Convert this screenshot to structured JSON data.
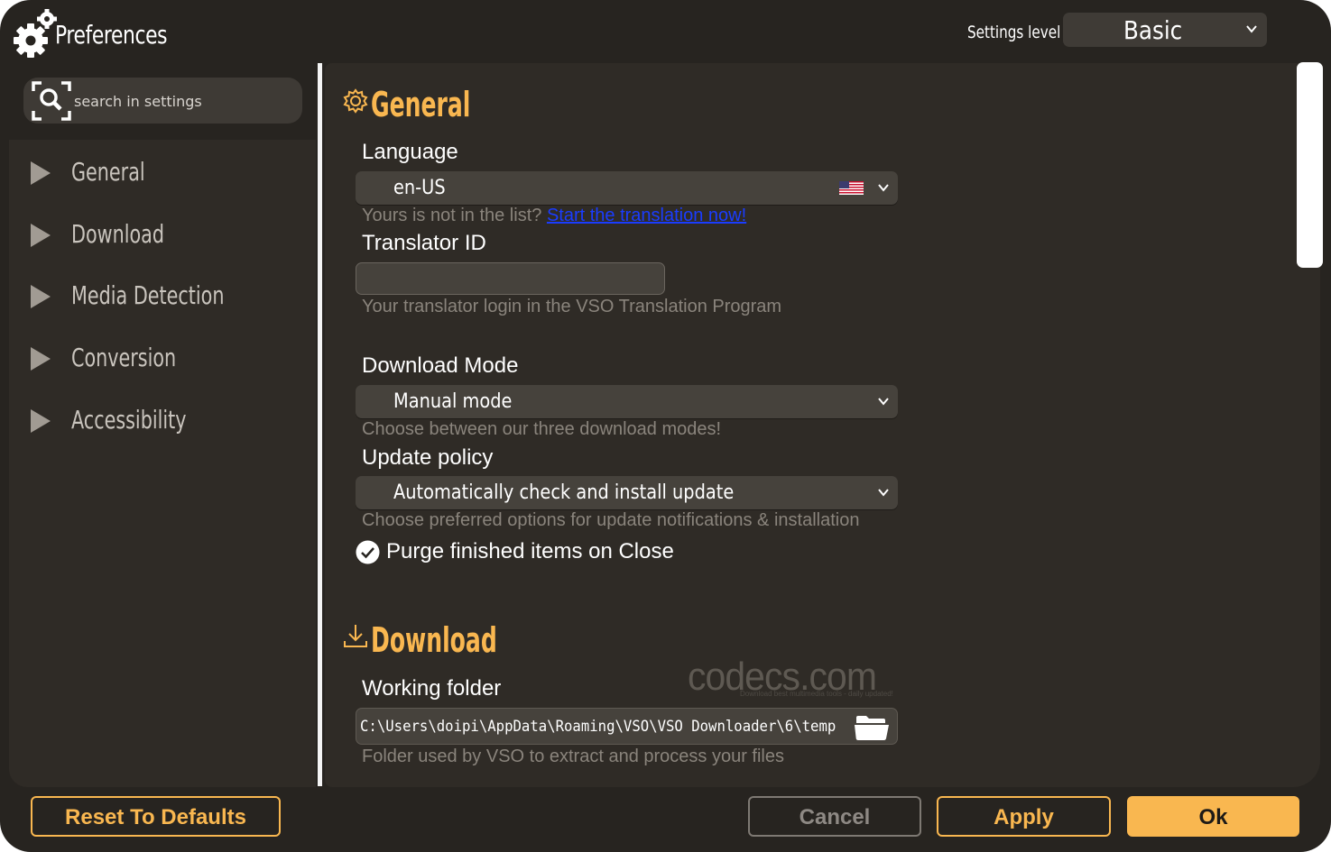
{
  "window": {
    "title": "Preferences"
  },
  "header": {
    "settings_level_label": "Settings level",
    "settings_level_value": "Basic"
  },
  "search": {
    "placeholder": "search in settings",
    "value": ""
  },
  "sidebar": {
    "items": [
      {
        "label": "General"
      },
      {
        "label": "Download"
      },
      {
        "label": "Media Detection"
      },
      {
        "label": "Conversion"
      },
      {
        "label": "Accessibility"
      }
    ]
  },
  "general": {
    "title": "General",
    "language": {
      "label": "Language",
      "value": "en-US",
      "hint_prefix": "Yours is not in the list?",
      "hint_link": "Start the translation now!"
    },
    "translator_id": {
      "label": "Translator ID",
      "value": "",
      "hint": "Your translator login in the VSO Translation Program"
    },
    "download_mode": {
      "label": "Download Mode",
      "value": "Manual mode",
      "hint": "Choose between our three download modes!"
    },
    "update_policy": {
      "label": "Update policy",
      "value": "Automatically check and install update",
      "hint": "Choose preferred options for update notifications & installation"
    },
    "purge": {
      "label": "Purge finished items on Close",
      "checked": true
    }
  },
  "download": {
    "title": "Download",
    "working_folder": {
      "label": "Working folder",
      "value": "C:\\Users\\doipi\\AppData\\Roaming\\VSO\\VSO Downloader\\6\\temp",
      "hint": "Folder used by VSO to extract and process your files"
    }
  },
  "watermark": {
    "text": "codecs.com",
    "subtext": "Download best multimedia tools - daily updated!"
  },
  "footer": {
    "reset_label": "Reset To Defaults",
    "cancel_label": "Cancel",
    "apply_label": "Apply",
    "ok_label": "Ok"
  },
  "colors": {
    "accent": "#f9b750",
    "background": "#272420",
    "panel": "#2f2b26",
    "field": "#46423c",
    "link": "#1a3cff"
  }
}
